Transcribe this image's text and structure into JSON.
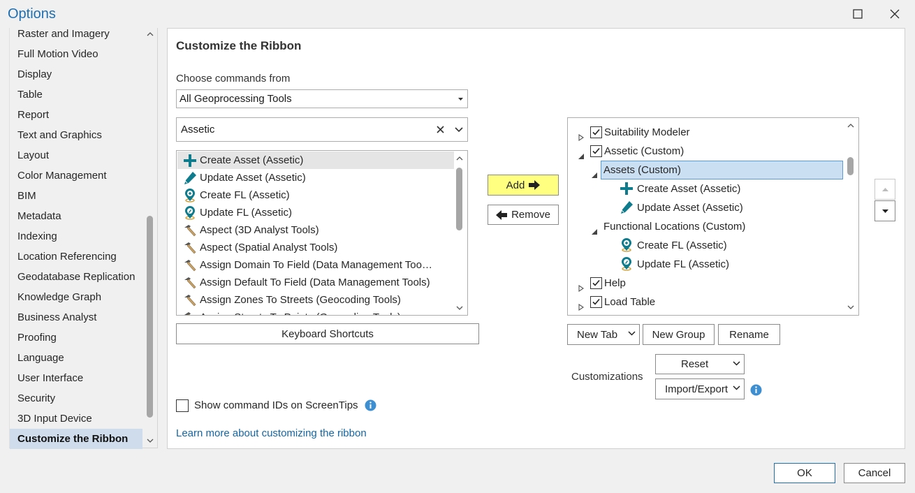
{
  "window": {
    "title": "Options",
    "maximize_icon": "maximize-icon",
    "close_icon": "close-icon"
  },
  "sidebar": {
    "items": [
      {
        "label": "Raster and Imagery"
      },
      {
        "label": "Full Motion Video"
      },
      {
        "label": "Display"
      },
      {
        "label": "Table"
      },
      {
        "label": "Report"
      },
      {
        "label": "Text and Graphics"
      },
      {
        "label": "Layout"
      },
      {
        "label": "Color Management"
      },
      {
        "label": "BIM"
      },
      {
        "label": "Metadata"
      },
      {
        "label": "Indexing"
      },
      {
        "label": "Location Referencing"
      },
      {
        "label": "Geodatabase Replication"
      },
      {
        "label": "Knowledge Graph"
      },
      {
        "label": "Business Analyst"
      },
      {
        "label": "Proofing"
      },
      {
        "label": "Language"
      },
      {
        "label": "User Interface"
      },
      {
        "label": "Security"
      },
      {
        "label": "3D Input Device"
      },
      {
        "label": "Customize the Ribbon",
        "selected": true
      }
    ]
  },
  "main": {
    "heading": "Customize the Ribbon",
    "choose_label": "Choose commands from",
    "choose_value": "All Geoprocessing Tools",
    "search_value": "Assetic",
    "commands": [
      {
        "label": "Create Asset (Assetic)",
        "icon": "plus-icon",
        "highlighted": true
      },
      {
        "label": "Update Asset (Assetic)",
        "icon": "pen-icon"
      },
      {
        "label": "Create FL (Assetic)",
        "icon": "location-add-icon"
      },
      {
        "label": "Update FL (Assetic)",
        "icon": "location-update-icon"
      },
      {
        "label": "Aspect (3D Analyst Tools)",
        "icon": "hammer-icon"
      },
      {
        "label": "Aspect (Spatial Analyst Tools)",
        "icon": "hammer-icon"
      },
      {
        "label": "Assign Domain To Field (Data Management Too…",
        "icon": "hammer-icon"
      },
      {
        "label": "Assign Default To Field (Data Management Tools)",
        "icon": "hammer-icon"
      },
      {
        "label": "Assign Zones To Streets (Geocoding Tools)",
        "icon": "hammer-icon"
      },
      {
        "label": "Assign Streets To Points (Geocoding Tools)",
        "icon": "hammer-icon"
      }
    ],
    "keyboard_shortcuts": "Keyboard Shortcuts",
    "add_label": "Add",
    "remove_label": "Remove",
    "tree": [
      {
        "label": "Suitability Modeler",
        "checkbox": true,
        "expander": "collapsed"
      },
      {
        "label": "Assetic (Custom)",
        "checkbox": true,
        "expander": "expanded"
      },
      {
        "label": "Assets (Custom)",
        "expander": "expanded",
        "selected": true
      },
      {
        "label": "Create Asset (Assetic)",
        "icon": "plus-icon"
      },
      {
        "label": "Update Asset (Assetic)",
        "icon": "pen-icon"
      },
      {
        "label": "Functional Locations (Custom)",
        "expander": "expanded"
      },
      {
        "label": "Create FL (Assetic)",
        "icon": "location-add-icon"
      },
      {
        "label": "Update FL (Assetic)",
        "icon": "location-update-icon"
      },
      {
        "label": "Help",
        "checkbox": true,
        "expander": "collapsed"
      },
      {
        "label": "Load Table",
        "checkbox": true,
        "expander": "collapsed"
      }
    ],
    "new_tab_label": "New Tab",
    "new_group_label": "New Group",
    "rename_label": "Rename",
    "customizations_label": "Customizations",
    "reset_label": "Reset",
    "import_export_label": "Import/Export",
    "show_ids_label": "Show command IDs on ScreenTips",
    "learn_more_link": "Learn more about customizing the ribbon"
  },
  "footer": {
    "ok_label": "OK",
    "cancel_label": "Cancel"
  },
  "colors": {
    "accent": "#1f6fb0",
    "add_button": "#ffff80",
    "selection": "#cbdff3",
    "nav_selected": "#cfdceb",
    "icon_teal": "#0e7c8c",
    "link": "#1466a5"
  }
}
